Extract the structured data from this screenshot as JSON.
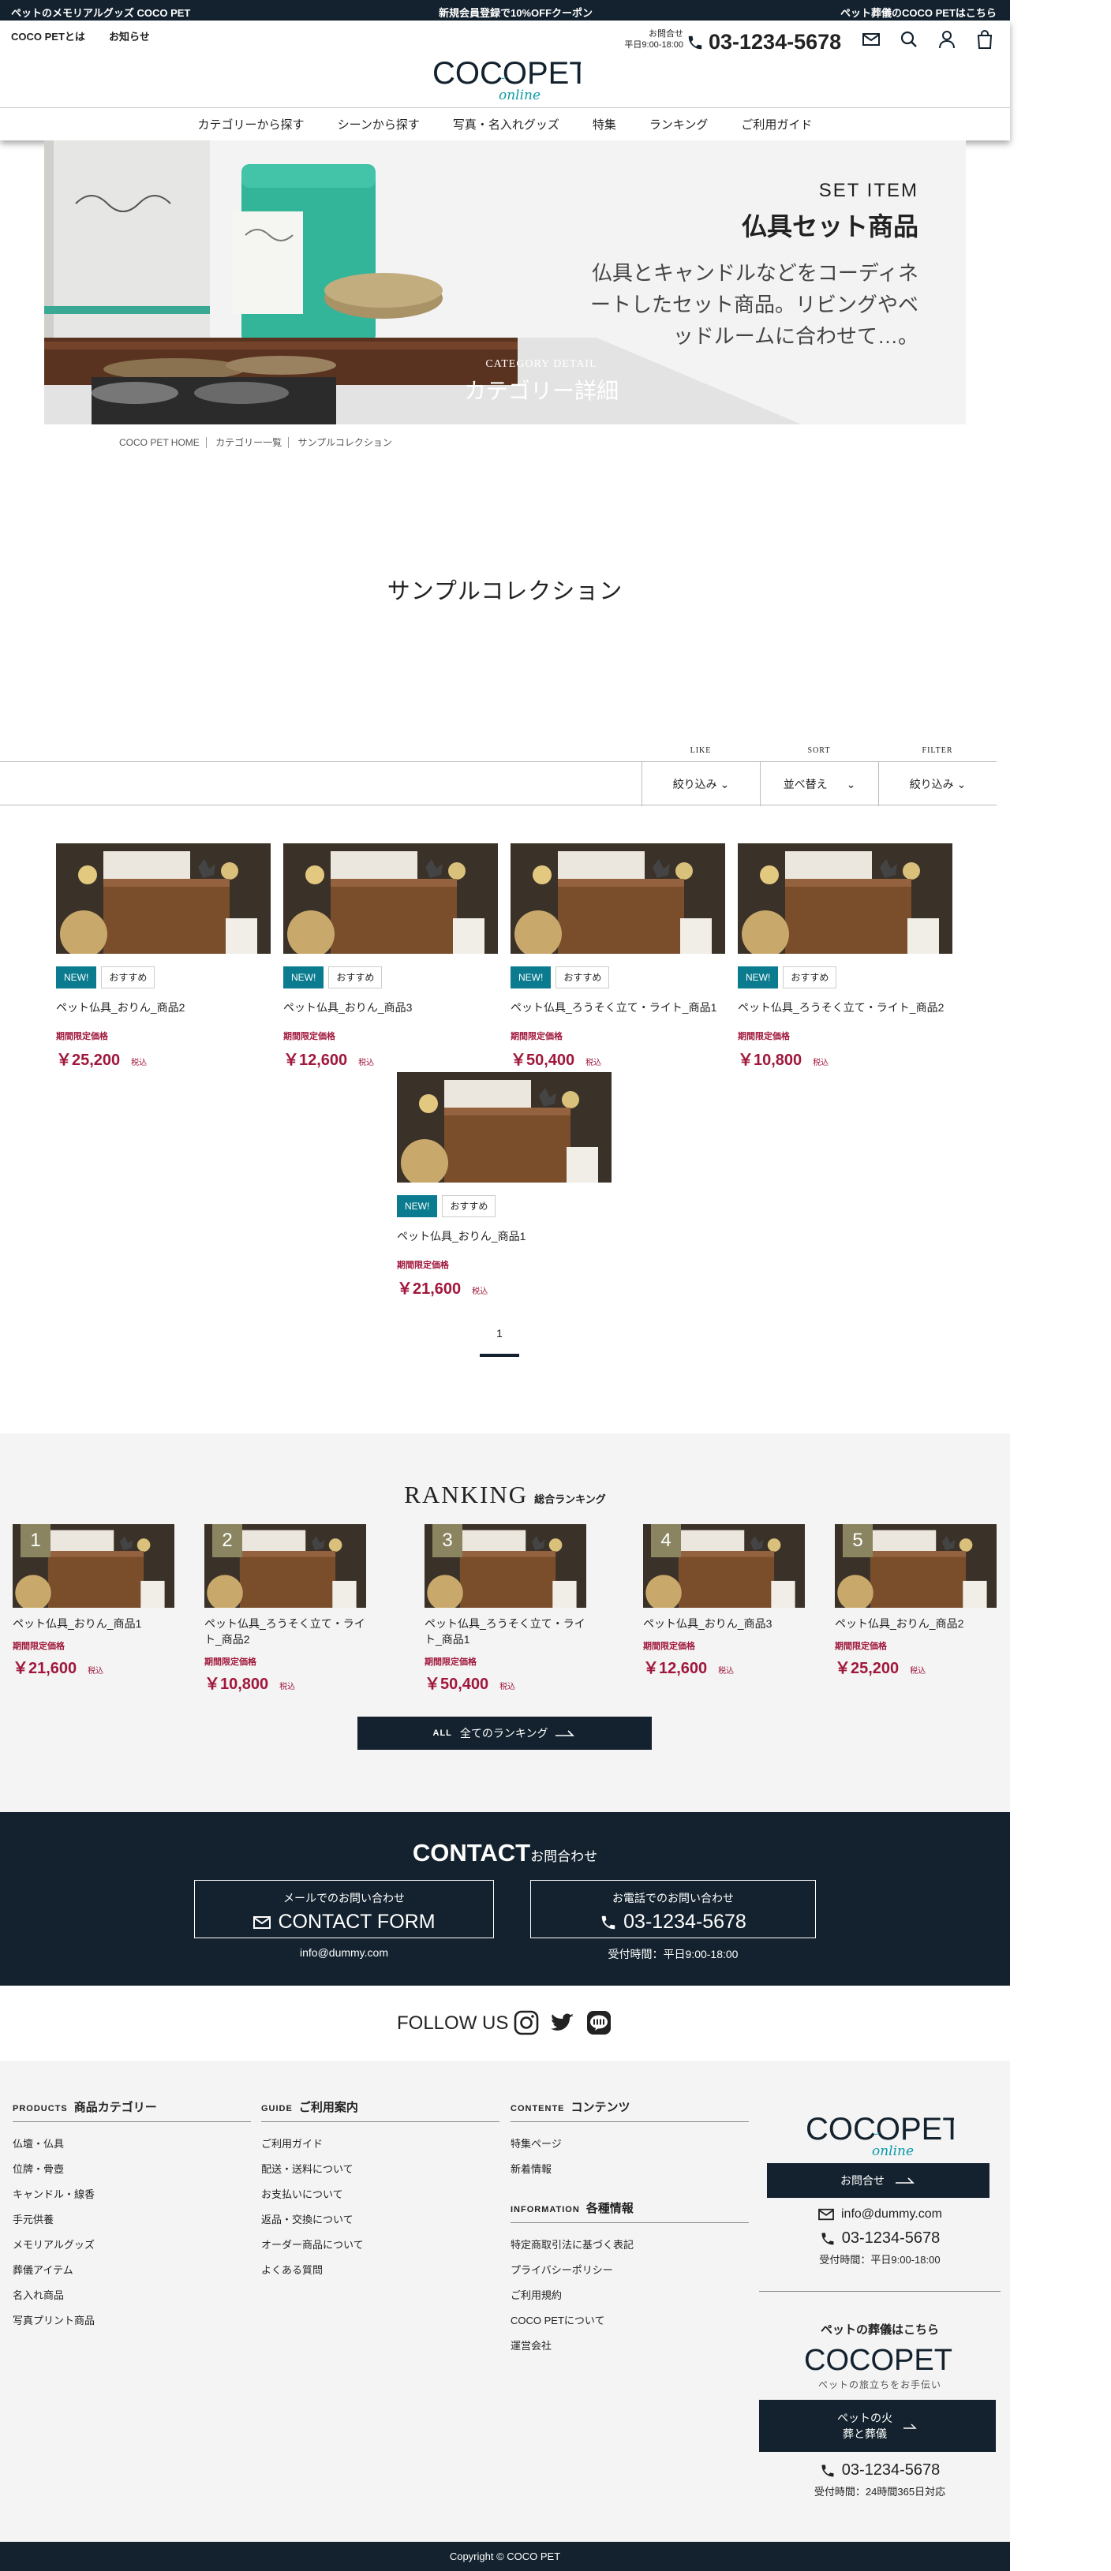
{
  "topbar": {
    "left": "ペットのメモリアルグッズ COCO PET",
    "center": "新規会員登録で10%OFFクーポン",
    "right": "ペット葬儀のCOCO PETはこちら"
  },
  "header": {
    "link_about": "COCO PETとは",
    "link_news": "お知らせ",
    "logo_main": "COCOPET",
    "logo_sub": "online",
    "hours_label": "お問合せ",
    "hours_value": "平日9:00-18:00",
    "phone": "03-1234-5678"
  },
  "nav": [
    "カテゴリーから探す",
    "シーンから探す",
    "写真・名入れグッズ",
    "特集",
    "ランキング",
    "ご利用ガイド"
  ],
  "hero": {
    "eyebrow": "SET ITEM",
    "title": "仏具セット商品",
    "desc": "仏具とキャンドルなどをコーディネートしたセット商品。リビングやベッドルームに合わせて…。",
    "badge_en": "CATEGORY DETAIL",
    "badge_ja": "カテゴリー詳細"
  },
  "breadcrumb": [
    "COCO PET HOME",
    "カテゴリー一覧",
    "サンプルコレクション"
  ],
  "page_title": "サンプルコレクション",
  "filters": [
    {
      "label": "LIKE",
      "value": "絞り込み"
    },
    {
      "label": "SORT",
      "value": "並べ替え"
    },
    {
      "label": "FILTER",
      "value": "絞り込み"
    }
  ],
  "products": [
    {
      "tag_new": "NEW!",
      "tag_rec": "おすすめ",
      "name": "ペット仏具_おりん_商品2",
      "label": "期間限定価格",
      "price": "￥25,200",
      "tax": "税込"
    },
    {
      "tag_new": "NEW!",
      "tag_rec": "おすすめ",
      "name": "ペット仏具_おりん_商品3",
      "label": "期間限定価格",
      "price": "￥12,600",
      "tax": "税込"
    },
    {
      "tag_new": "NEW!",
      "tag_rec": "おすすめ",
      "name": "ペット仏具_ろうそく立て・ライト_商品1",
      "label": "期間限定価格",
      "price": "￥50,400",
      "tax": "税込"
    },
    {
      "tag_new": "NEW!",
      "tag_rec": "おすすめ",
      "name": "ペット仏具_ろうそく立て・ライト_商品2",
      "label": "期間限定価格",
      "price": "￥10,800",
      "tax": "税込"
    },
    {
      "tag_new": "NEW!",
      "tag_rec": "おすすめ",
      "name": "ペット仏具_おりん_商品1",
      "label": "期間限定価格",
      "price": "￥21,600",
      "tax": "税込"
    }
  ],
  "pagination": {
    "current": "1"
  },
  "ranking": {
    "title": "RANKING",
    "subtitle": "総合ランキング",
    "items": [
      {
        "rank": "1",
        "name": "ペット仏具_おりん_商品1",
        "label": "期間限定価格",
        "price": "￥21,600",
        "tax": "税込"
      },
      {
        "rank": "2",
        "name": "ペット仏具_ろうそく立て・ライト_商品2",
        "label": "期間限定価格",
        "price": "￥10,800",
        "tax": "税込"
      },
      {
        "rank": "3",
        "name": "ペット仏具_ろうそく立て・ライト_商品1",
        "label": "期間限定価格",
        "price": "￥50,400",
        "tax": "税込"
      },
      {
        "rank": "4",
        "name": "ペット仏具_おりん_商品3",
        "label": "期間限定価格",
        "price": "￥12,600",
        "tax": "税込"
      },
      {
        "rank": "5",
        "name": "ペット仏具_おりん_商品2",
        "label": "期間限定価格",
        "price": "￥25,200",
        "tax": "税込"
      }
    ],
    "button_en": "ALL",
    "button_ja": "全てのランキング"
  },
  "contact": {
    "title": "CONTACT",
    "title_ja": "お問合わせ",
    "mail_small": "メールでのお問い合わせ",
    "mail_big": "CONTACT FORM",
    "mail_address": "info@dummy.com",
    "tel_small": "お電話でのお問い合わせ",
    "tel_big": "03-1234-5678",
    "tel_hours": "受付時間：平日9:00-18:00"
  },
  "follow": {
    "title": "FOLLOW US"
  },
  "footer": {
    "products": {
      "en": "PRODUCTS",
      "ja": "商品カテゴリー",
      "items": [
        "仏壇・仏具",
        "位牌・骨壺",
        "キャンドル・線香",
        "手元供養",
        "メモリアルグッズ",
        "葬儀アイテム",
        "名入れ商品",
        "写真プリント商品"
      ]
    },
    "guide": {
      "en": "GUIDE",
      "ja": "ご利用案内",
      "items": [
        "ご利用ガイド",
        "配送・送料について",
        "お支払いについて",
        "返品・交換について",
        "オーダー商品について",
        "よくある質問"
      ]
    },
    "contents": {
      "en": "CONTENTE",
      "ja": "コンテンツ",
      "items": [
        "特集ページ",
        "新着情報"
      ]
    },
    "information": {
      "en": "INFORMATION",
      "ja": "各種情報",
      "items": [
        "特定商取引法に基づく表記",
        "プライバシーポリシー",
        "ご利用規約",
        "COCO PETについて",
        "運営会社"
      ]
    },
    "right": {
      "logo_main": "COCOPET",
      "logo_sub": "online",
      "contact_btn": "お問合せ",
      "email": "info@dummy.com",
      "phone": "03-1234-5678",
      "hours": "受付時間：平日9:00-18:00",
      "funeral_heading": "ペットの葬儀はこちら",
      "funeral_logo": "COCOPET",
      "funeral_tagline": "ペットの旅立ちをお手伝い",
      "funeral_btn_line1": "ペットの火",
      "funeral_btn_line2": "葬と葬儀",
      "funeral_phone": "03-1234-5678",
      "funeral_hours": "受付時間：24時間365日対応"
    }
  },
  "copyright": "Copyright © COCO PET",
  "colors": {
    "navy": "#13222e",
    "teal": "#0b7c8f",
    "price": "#a0173b",
    "rank_badge": "#8a8560"
  },
  "icons": [
    "phone-icon",
    "mail-icon",
    "search-icon",
    "user-icon",
    "cart-icon",
    "instagram-icon",
    "twitter-icon",
    "line-icon",
    "arrow-right-icon",
    "chevron-down-icon"
  ]
}
